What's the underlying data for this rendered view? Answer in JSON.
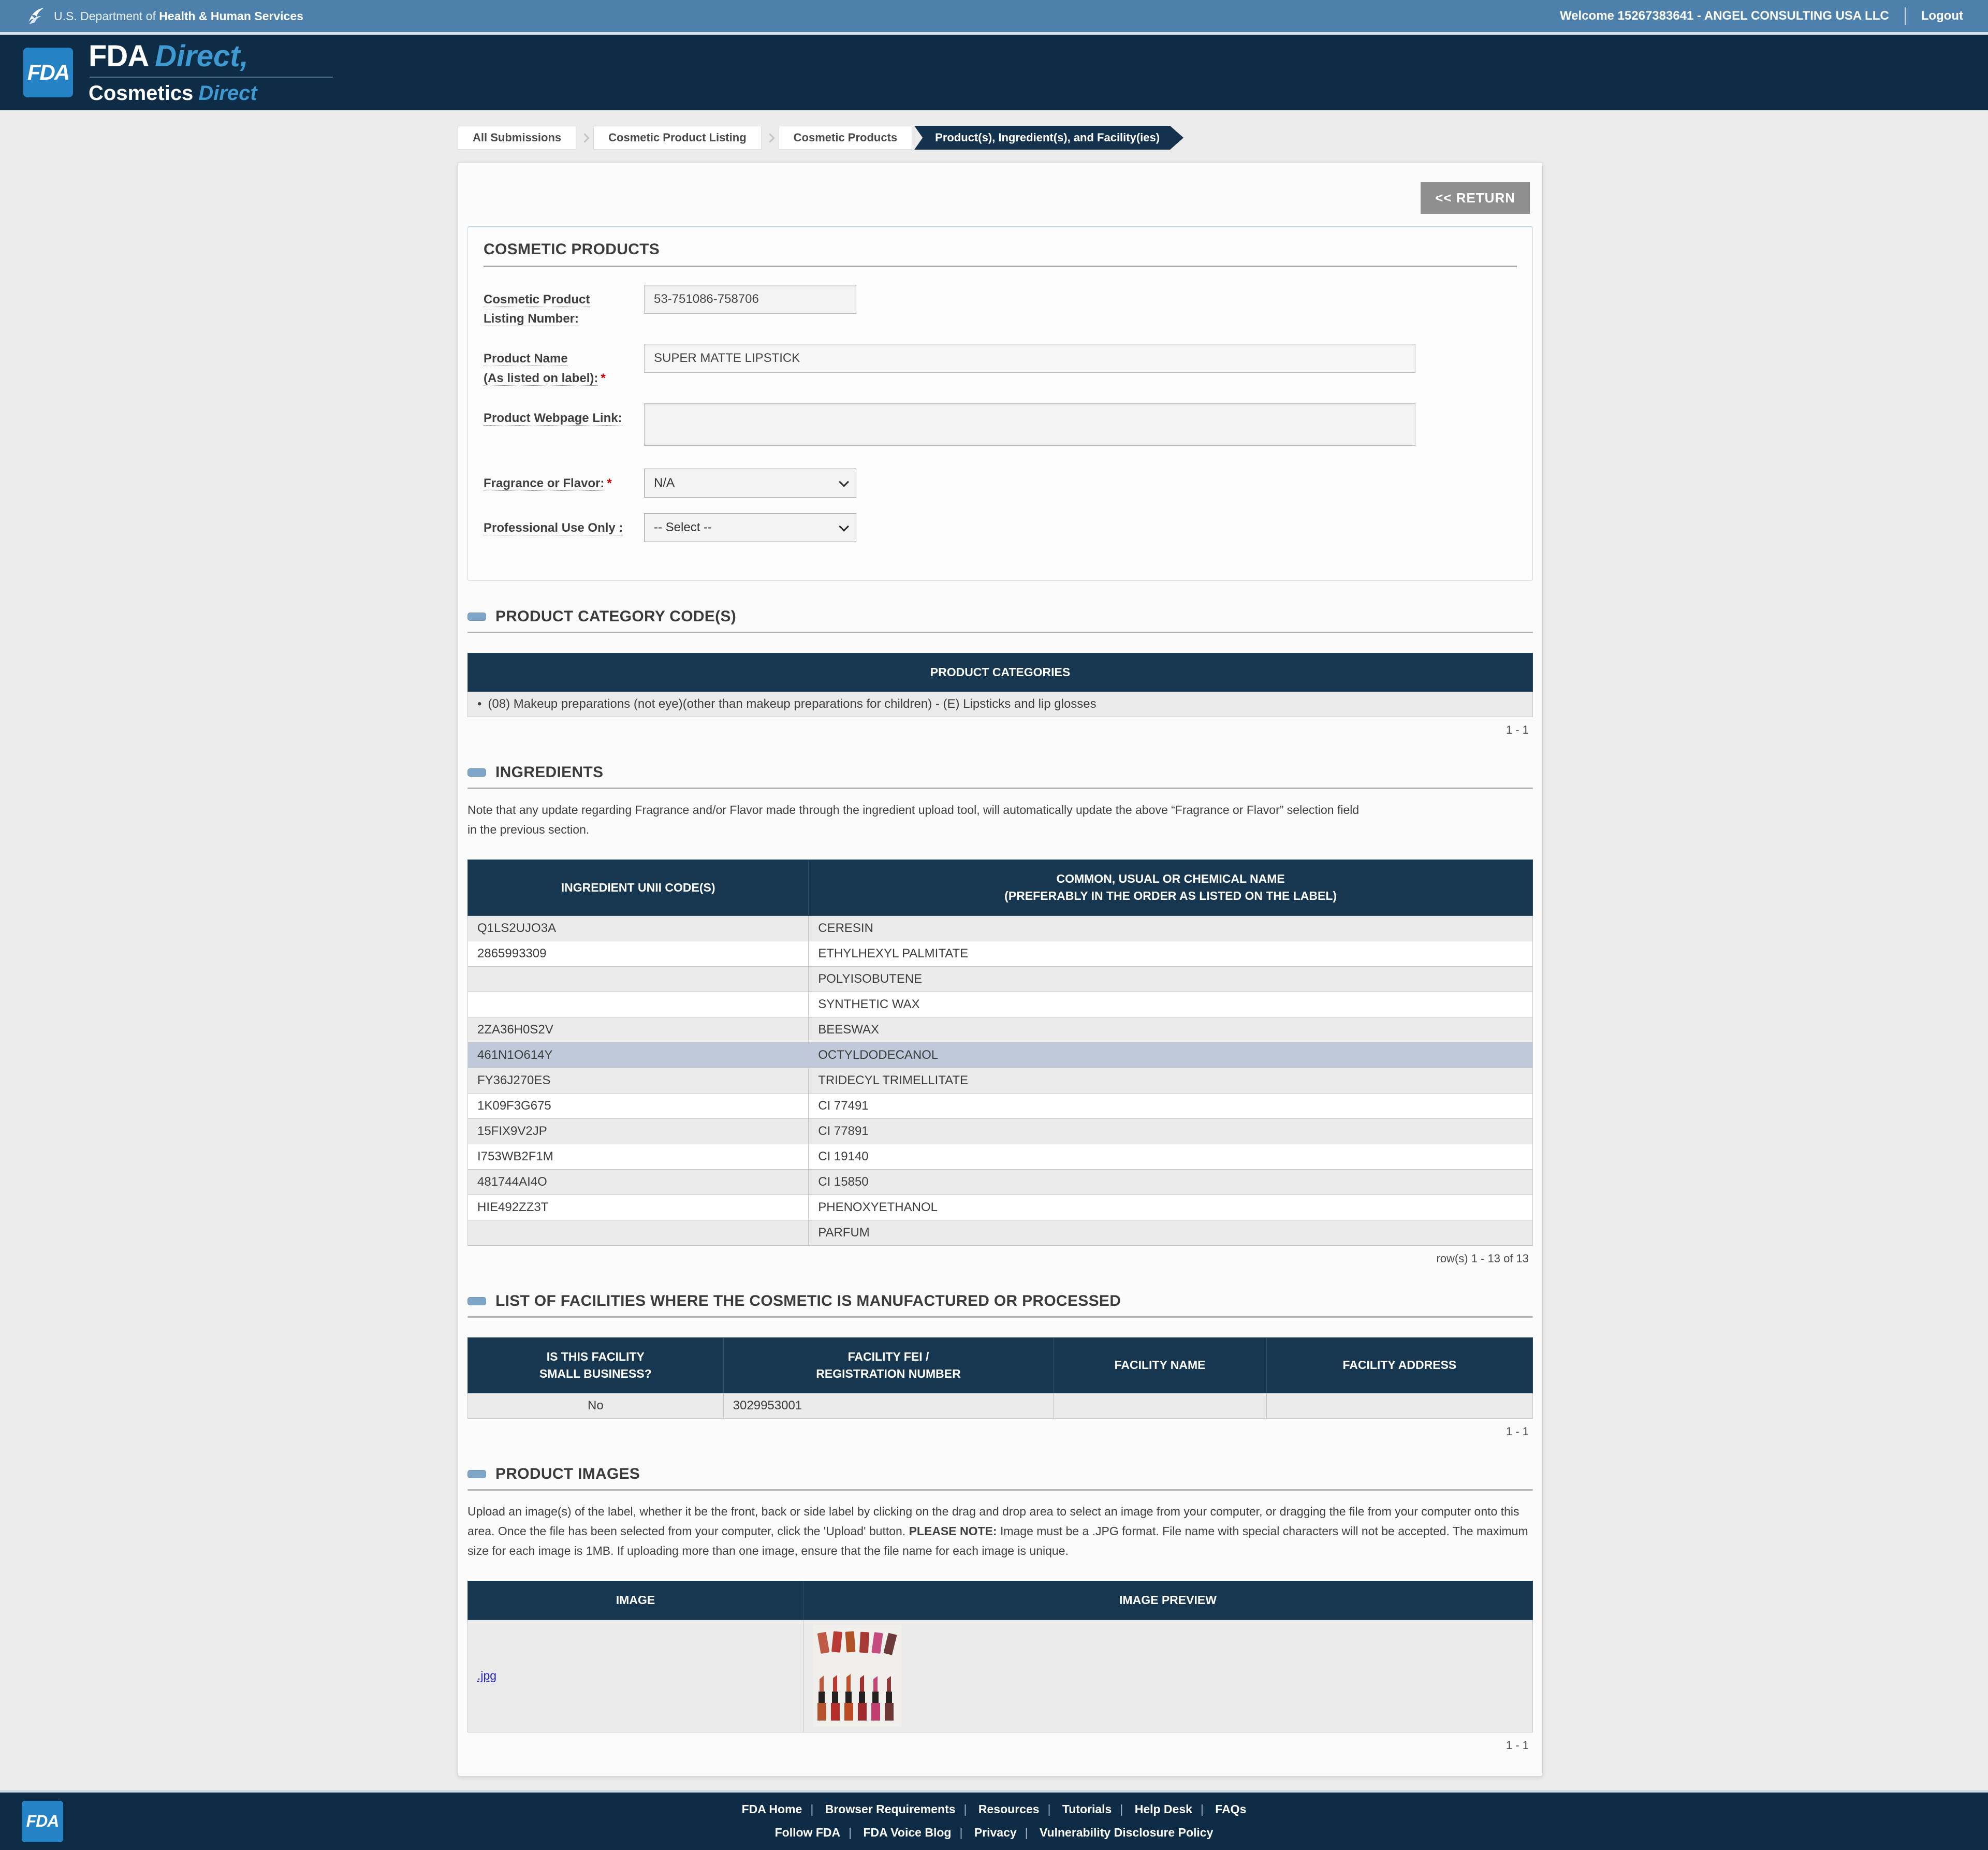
{
  "colors": {
    "hhs_bar": "#4d81ab",
    "brand_navy": "#0f2c47",
    "table_header_navy": "#16374f",
    "logo_blue": "#2583c5",
    "brand_accent_blue": "#3f9ad2",
    "highlight_row": "#bfc9d9",
    "link_blue": "#2526c9",
    "return_gray": "#8f8f8f",
    "required_red": "#cc0000"
  },
  "header": {
    "hhs_prefix": "U.S. Department of",
    "hhs_bold": "Health & Human Services",
    "welcome_text": "Welcome 15267383641 - ANGEL CONSULTING USA LLC",
    "logout_label": "Logout",
    "fda_logo_text": "FDA",
    "brand_line1_bold": "FDA",
    "brand_line1_italic": "Direct,",
    "brand_line2_bold": "Cosmetics",
    "brand_line2_italic": "Direct"
  },
  "breadcrumb": {
    "items": [
      {
        "label": "All Submissions"
      },
      {
        "label": "Cosmetic Product Listing"
      },
      {
        "label": "Cosmetic Products"
      },
      {
        "label": "Product(s), Ingredient(s), and Facility(ies)"
      }
    ]
  },
  "toolbar": {
    "return_label": "<< RETURN"
  },
  "product_form": {
    "section_title": "COSMETIC PRODUCTS",
    "listing_number": {
      "label_line1": "Cosmetic Product",
      "label_line2": "Listing Number:",
      "value": "53-751086-758706"
    },
    "product_name": {
      "label_line1": "Product Name",
      "label_line2": "(As listed on label):",
      "required_mark": "*",
      "value": "SUPER MATTE LIPSTICK"
    },
    "webpage_link": {
      "label": "Product Webpage Link:",
      "value": ""
    },
    "fragrance": {
      "label": "Fragrance or Flavor:",
      "required_mark": "*",
      "selected": "N/A"
    },
    "professional": {
      "label": "Professional Use Only :",
      "selected": "-- Select --"
    }
  },
  "categories_section": {
    "title": "PRODUCT CATEGORY CODE(S)",
    "table_header": "PRODUCT CATEGORIES",
    "bullet": "•",
    "rows": [
      {
        "label": "(08) Makeup preparations (not eye)(other than makeup preparations for children) - (E) Lipsticks and lip glosses"
      }
    ],
    "pagination": "1 - 1"
  },
  "ingredients_section": {
    "title": "INGREDIENTS",
    "note_line1": "Note that any update regarding Fragrance and/or Flavor made through the ingredient upload tool, will automatically update the above “Fragrance or Flavor” selection field",
    "note_line2": "in the previous section.",
    "col1_header": "INGREDIENT UNII CODE(S)",
    "col2_header_line1": "COMMON, USUAL OR CHEMICAL NAME",
    "col2_header_line2": "(PREFERABLY IN THE ORDER AS LISTED ON THE LABEL)",
    "rows": [
      {
        "code": "Q1LS2UJO3A",
        "name": "CERESIN"
      },
      {
        "code": "2865993309",
        "name": "ETHYLHEXYL PALMITATE"
      },
      {
        "code": "",
        "name": "POLYISOBUTENE"
      },
      {
        "code": "",
        "name": "SYNTHETIC WAX"
      },
      {
        "code": "2ZA36H0S2V",
        "name": "BEESWAX"
      },
      {
        "code": "461N1O614Y",
        "name": "OCTYLDODECANOL"
      },
      {
        "code": "FY36J270ES",
        "name": "TRIDECYL TRIMELLITATE"
      },
      {
        "code": "1K09F3G675",
        "name": "CI 77491"
      },
      {
        "code": "15FIX9V2JP",
        "name": "CI 77891"
      },
      {
        "code": "I753WB2F1M",
        "name": "CI 19140"
      },
      {
        "code": "481744AI4O",
        "name": "CI 15850"
      },
      {
        "code": "HIE492ZZ3T",
        "name": "PHENOXYETHANOL"
      },
      {
        "code": "",
        "name": "PARFUM"
      }
    ],
    "pagination": "row(s) 1 - 13 of 13"
  },
  "facilities_section": {
    "title": "LIST OF FACILITIES WHERE THE COSMETIC IS MANUFACTURED OR PROCESSED",
    "col1_line1": "IS THIS FACILITY",
    "col1_line2": "SMALL BUSINESS?",
    "col2_line1": "FACILITY FEI /",
    "col2_line2": "REGISTRATION NUMBER",
    "col3": "FACILITY NAME",
    "col4": "FACILITY ADDRESS",
    "rows": [
      {
        "small_business": "No",
        "fei_number": "3029953001",
        "facility_name": "",
        "facility_address": ""
      }
    ],
    "pagination": "1 - 1"
  },
  "images_section": {
    "title": "PRODUCT IMAGES",
    "instructions_part1": "Upload an image(s) of the label, whether it be the front, back or side label by clicking on the drag and drop area to select an image from your computer, or dragging the file from your computer onto this area. Once the file has been selected from your computer, click the 'Upload' button. ",
    "instructions_bold": "PLEASE NOTE:",
    "instructions_part2": " Image must be a .JPG format. File name with special characters will not be accepted. The maximum size for each image is 1MB. If uploading more than one image, ensure that the file name for each image is unique.",
    "col1_header": "IMAGE",
    "col2_header": "IMAGE PREVIEW",
    "rows": [
      {
        "file_label": ".jpg"
      }
    ],
    "pagination": "1 - 1"
  },
  "footer": {
    "fda_logo_text": "FDA",
    "links_row1": [
      "FDA Home",
      "Browser Requirements",
      "Resources",
      "Tutorials",
      "Help Desk",
      "FAQs"
    ],
    "links_row2": [
      "Follow FDA",
      "FDA Voice Blog",
      "Privacy",
      "Vulnerability Disclosure Policy"
    ]
  }
}
